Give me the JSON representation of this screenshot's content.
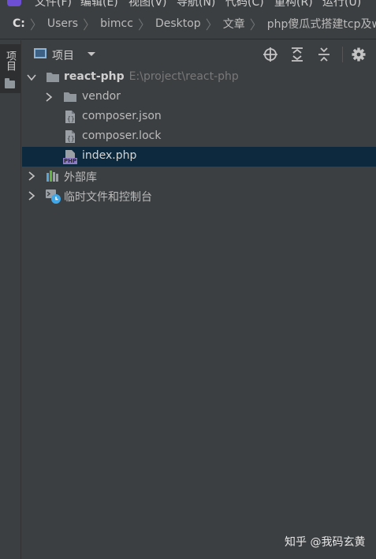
{
  "menubar": {
    "items": [
      "文件(F)",
      "编辑(E)",
      "视图(V)",
      "导航(N)",
      "代码(C)",
      "重构(R)",
      "运行(U)"
    ]
  },
  "breadcrumb": {
    "items": [
      "C:",
      "Users",
      "bimcc",
      "Desktop",
      "文章",
      "php傻瓜式搭建tcp及websock"
    ]
  },
  "side_stripe": {
    "project_tab": "项目"
  },
  "panel": {
    "title": "项目",
    "toolbar": [
      "locate-icon",
      "expand-all-icon",
      "collapse-all-icon",
      "settings-icon"
    ]
  },
  "tree": {
    "root": {
      "label": "react-php",
      "path": "E:\\project\\react-php"
    },
    "vendor": "vendor",
    "composer_json": "composer.json",
    "composer_lock": "composer.lock",
    "index_php": "index.php",
    "external_libs": "外部库",
    "scratches": "临时文件和控制台"
  },
  "icons": {
    "php_badge": "PHP"
  },
  "colors": {
    "background": "#3c3f41",
    "selection": "#0d293e",
    "folder": "#8f969c",
    "php": "#8e7cc3"
  },
  "watermark": "知乎 @我码玄黄"
}
